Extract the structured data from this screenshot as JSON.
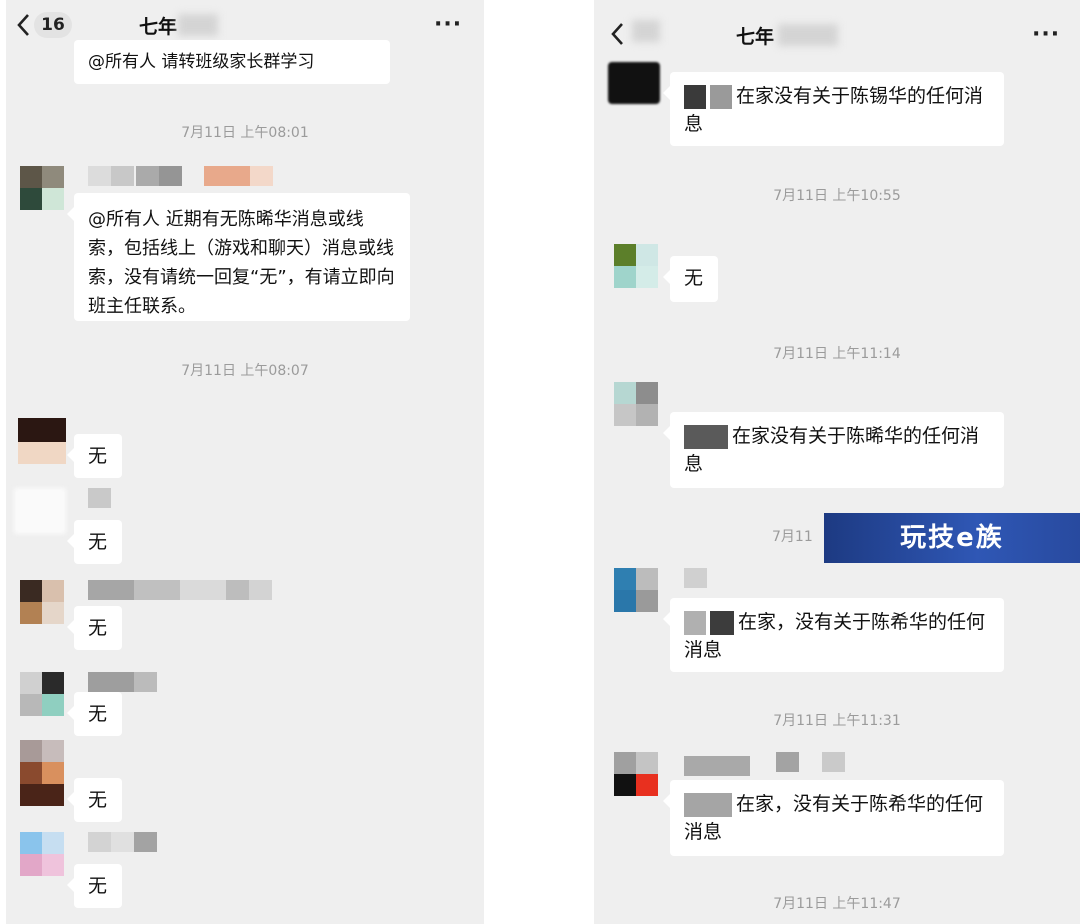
{
  "left": {
    "back_count": "16",
    "title": "七年",
    "more": "···",
    "messages": {
      "top_partial": "@所有人 请转班级家长群学习",
      "time1": "7月11日 上午08:01",
      "announce": "@所有人 近期有无陈晞华消息或线索，包括线上（游戏和聊天）消息或线索，没有请统一回复“无”，有请立即向班主任联系。",
      "time2": "7月11日 上午08:07",
      "reply": "无"
    }
  },
  "right": {
    "title": "七年",
    "more": "···",
    "messages": {
      "m1": "在家没有关于陈锡华的任何消息",
      "time1": "7月11日 上午10:55",
      "m2": "无",
      "time2": "7月11日 上午11:14",
      "m3": "在家没有关于陈晞华的任何消息",
      "time3_partial": "7月11",
      "m4": "在家，没有关于陈希华的任何消息",
      "time4": "7月11日 上午11:31",
      "m5": "在家，没有关于陈希华的任何消息",
      "time5": "7月11日 上午11:47"
    }
  },
  "watermark": "玩技e族"
}
